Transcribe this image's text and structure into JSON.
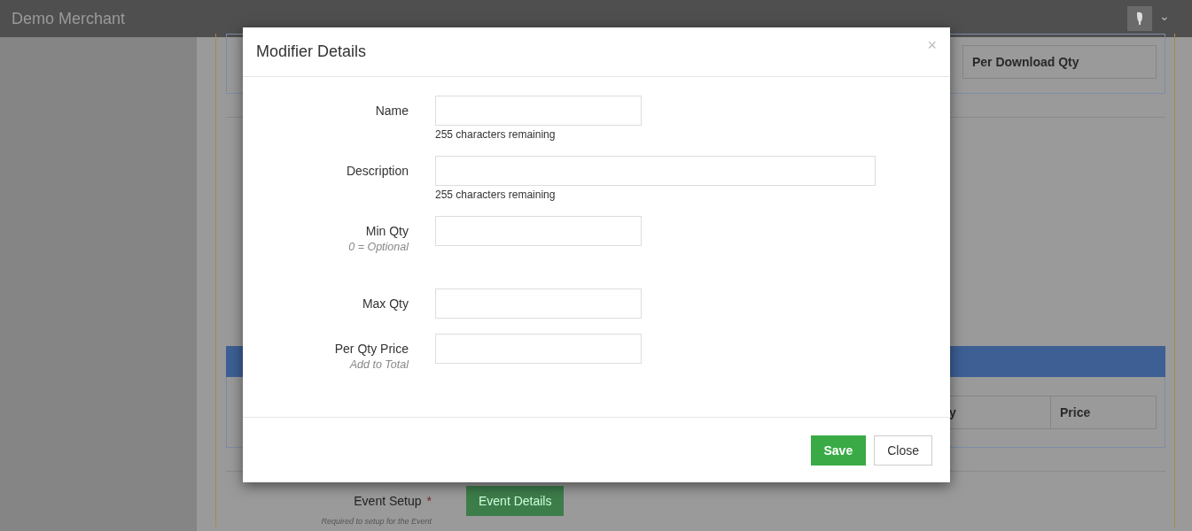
{
  "header": {
    "title": "Demo Merchant",
    "menu_caret": "⌄"
  },
  "background": {
    "top_table": {
      "columns": [
        "Per Download Qty"
      ]
    },
    "lower_panel": {
      "columns": [
        "y",
        "Price"
      ]
    },
    "event_setup": {
      "label": "Event Setup",
      "required_mark": "*",
      "hint": "Required to setup for the Event",
      "button": "Event Details"
    }
  },
  "modal": {
    "title": "Modifier Details",
    "close": "×",
    "fields": [
      {
        "label": "Name",
        "kind": "short",
        "counter": "255 characters remaining"
      },
      {
        "label": "Description",
        "kind": "long",
        "counter": "255 characters remaining"
      },
      {
        "label": "Min Qty",
        "kind": "short",
        "hint": "0 = Optional"
      },
      {
        "label": "Max Qty",
        "kind": "short"
      },
      {
        "label": "Per Qty Price",
        "kind": "short",
        "hint": "Add to Total"
      }
    ],
    "buttons": [
      {
        "label": "Save",
        "kind": "primary"
      },
      {
        "label": "Close",
        "kind": "default"
      }
    ]
  }
}
